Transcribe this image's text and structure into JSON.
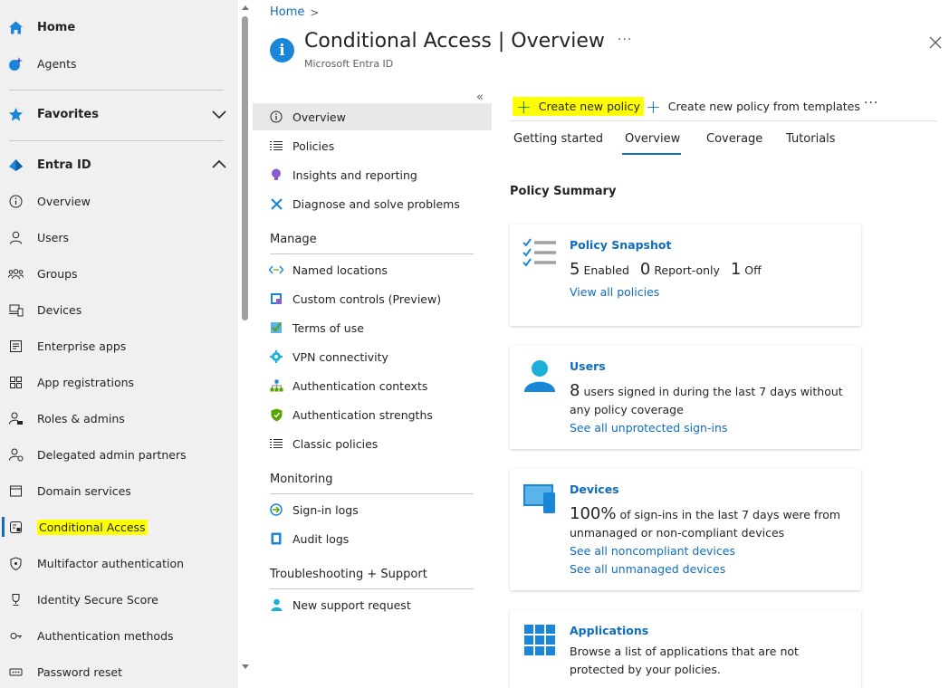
{
  "leftnav": {
    "home": "Home",
    "agents": "Agents",
    "favorites": "Favorites",
    "entra_id": "Entra ID",
    "items": [
      "Overview",
      "Users",
      "Groups",
      "Devices",
      "Enterprise apps",
      "App registrations",
      "Roles & admins",
      "Delegated admin partners",
      "Domain services",
      "Conditional Access",
      "Multifactor authentication",
      "Identity Secure Score",
      "Authentication methods",
      "Password reset"
    ]
  },
  "header": {
    "breadcrumb_home": "Home",
    "breadcrumb_sep": ">",
    "title": "Conditional Access | Overview",
    "subtitle": "Microsoft Entra ID",
    "more": "···",
    "info_glyph": "i"
  },
  "resource_menu": {
    "collapse": "«",
    "top_items": [
      "Overview",
      "Policies",
      "Insights and reporting",
      "Diagnose and solve problems"
    ],
    "manage_label": "Manage",
    "manage_items": [
      "Named locations",
      "Custom controls (Preview)",
      "Terms of use",
      "VPN connectivity",
      "Authentication contexts",
      "Authentication strengths",
      "Classic policies"
    ],
    "monitoring_label": "Monitoring",
    "monitoring_items": [
      "Sign-in logs",
      "Audit logs"
    ],
    "support_label": "Troubleshooting + Support",
    "support_items": [
      "New support request"
    ]
  },
  "command_bar": {
    "create": "Create new policy",
    "create_templates": "Create new policy from templates",
    "more": "···"
  },
  "tabs": [
    "Getting started",
    "Overview",
    "Coverage",
    "Tutorials"
  ],
  "active_tab": "Overview",
  "policy_summary": "Policy Summary",
  "cards": {
    "snapshot": {
      "title": "Policy Snapshot",
      "enabled_num": "5",
      "enabled_lbl": "Enabled",
      "report_num": "0",
      "report_lbl": "Report-only",
      "off_num": "1",
      "off_lbl": "Off",
      "link": "View all policies"
    },
    "users": {
      "title": "Users",
      "num": "8",
      "text": "users signed in during the last 7 days without any policy coverage",
      "link": "See all unprotected sign-ins"
    },
    "devices": {
      "title": "Devices",
      "num": "100%",
      "text": "of sign-ins in the last 7 days were from unmanaged or non-compliant devices",
      "link1": "See all noncompliant devices",
      "link2": "See all unmanaged devices"
    },
    "applications": {
      "title": "Applications",
      "text": "Browse a list of applications that are not protected by your policies."
    }
  },
  "colors": {
    "accent": "#0f6cbd",
    "highlight": "#ffff00",
    "nav_bg": "#f0f0f0"
  }
}
